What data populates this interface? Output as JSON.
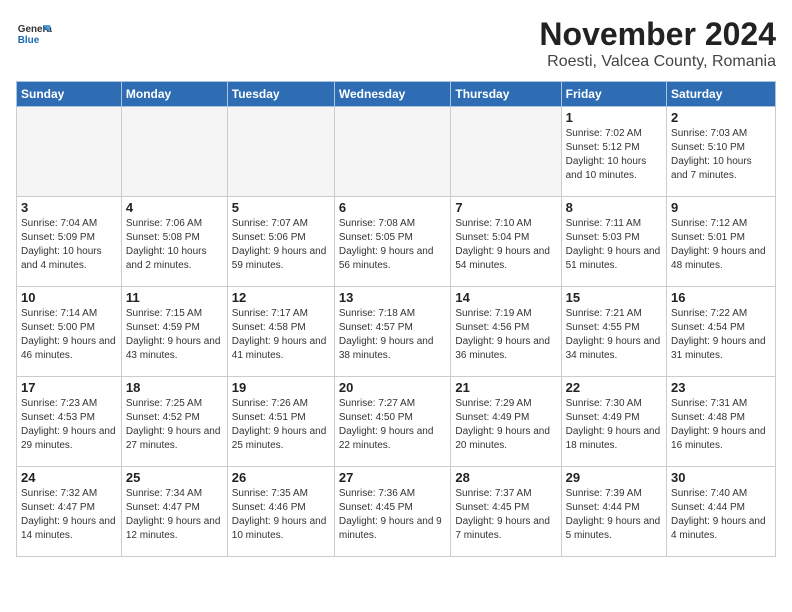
{
  "header": {
    "logo_general": "General",
    "logo_blue": "Blue",
    "month_title": "November 2024",
    "location": "Roesti, Valcea County, Romania"
  },
  "days_of_week": [
    "Sunday",
    "Monday",
    "Tuesday",
    "Wednesday",
    "Thursday",
    "Friday",
    "Saturday"
  ],
  "weeks": [
    [
      {
        "day": "",
        "empty": true
      },
      {
        "day": "",
        "empty": true
      },
      {
        "day": "",
        "empty": true
      },
      {
        "day": "",
        "empty": true
      },
      {
        "day": "",
        "empty": true
      },
      {
        "day": "1",
        "sunrise": "7:02 AM",
        "sunset": "5:12 PM",
        "daylight": "10 hours and 10 minutes."
      },
      {
        "day": "2",
        "sunrise": "7:03 AM",
        "sunset": "5:10 PM",
        "daylight": "10 hours and 7 minutes."
      }
    ],
    [
      {
        "day": "3",
        "sunrise": "7:04 AM",
        "sunset": "5:09 PM",
        "daylight": "10 hours and 4 minutes."
      },
      {
        "day": "4",
        "sunrise": "7:06 AM",
        "sunset": "5:08 PM",
        "daylight": "10 hours and 2 minutes."
      },
      {
        "day": "5",
        "sunrise": "7:07 AM",
        "sunset": "5:06 PM",
        "daylight": "9 hours and 59 minutes."
      },
      {
        "day": "6",
        "sunrise": "7:08 AM",
        "sunset": "5:05 PM",
        "daylight": "9 hours and 56 minutes."
      },
      {
        "day": "7",
        "sunrise": "7:10 AM",
        "sunset": "5:04 PM",
        "daylight": "9 hours and 54 minutes."
      },
      {
        "day": "8",
        "sunrise": "7:11 AM",
        "sunset": "5:03 PM",
        "daylight": "9 hours and 51 minutes."
      },
      {
        "day": "9",
        "sunrise": "7:12 AM",
        "sunset": "5:01 PM",
        "daylight": "9 hours and 48 minutes."
      }
    ],
    [
      {
        "day": "10",
        "sunrise": "7:14 AM",
        "sunset": "5:00 PM",
        "daylight": "9 hours and 46 minutes."
      },
      {
        "day": "11",
        "sunrise": "7:15 AM",
        "sunset": "4:59 PM",
        "daylight": "9 hours and 43 minutes."
      },
      {
        "day": "12",
        "sunrise": "7:17 AM",
        "sunset": "4:58 PM",
        "daylight": "9 hours and 41 minutes."
      },
      {
        "day": "13",
        "sunrise": "7:18 AM",
        "sunset": "4:57 PM",
        "daylight": "9 hours and 38 minutes."
      },
      {
        "day": "14",
        "sunrise": "7:19 AM",
        "sunset": "4:56 PM",
        "daylight": "9 hours and 36 minutes."
      },
      {
        "day": "15",
        "sunrise": "7:21 AM",
        "sunset": "4:55 PM",
        "daylight": "9 hours and 34 minutes."
      },
      {
        "day": "16",
        "sunrise": "7:22 AM",
        "sunset": "4:54 PM",
        "daylight": "9 hours and 31 minutes."
      }
    ],
    [
      {
        "day": "17",
        "sunrise": "7:23 AM",
        "sunset": "4:53 PM",
        "daylight": "9 hours and 29 minutes."
      },
      {
        "day": "18",
        "sunrise": "7:25 AM",
        "sunset": "4:52 PM",
        "daylight": "9 hours and 27 minutes."
      },
      {
        "day": "19",
        "sunrise": "7:26 AM",
        "sunset": "4:51 PM",
        "daylight": "9 hours and 25 minutes."
      },
      {
        "day": "20",
        "sunrise": "7:27 AM",
        "sunset": "4:50 PM",
        "daylight": "9 hours and 22 minutes."
      },
      {
        "day": "21",
        "sunrise": "7:29 AM",
        "sunset": "4:49 PM",
        "daylight": "9 hours and 20 minutes."
      },
      {
        "day": "22",
        "sunrise": "7:30 AM",
        "sunset": "4:49 PM",
        "daylight": "9 hours and 18 minutes."
      },
      {
        "day": "23",
        "sunrise": "7:31 AM",
        "sunset": "4:48 PM",
        "daylight": "9 hours and 16 minutes."
      }
    ],
    [
      {
        "day": "24",
        "sunrise": "7:32 AM",
        "sunset": "4:47 PM",
        "daylight": "9 hours and 14 minutes."
      },
      {
        "day": "25",
        "sunrise": "7:34 AM",
        "sunset": "4:47 PM",
        "daylight": "9 hours and 12 minutes."
      },
      {
        "day": "26",
        "sunrise": "7:35 AM",
        "sunset": "4:46 PM",
        "daylight": "9 hours and 10 minutes."
      },
      {
        "day": "27",
        "sunrise": "7:36 AM",
        "sunset": "4:45 PM",
        "daylight": "9 hours and 9 minutes."
      },
      {
        "day": "28",
        "sunrise": "7:37 AM",
        "sunset": "4:45 PM",
        "daylight": "9 hours and 7 minutes."
      },
      {
        "day": "29",
        "sunrise": "7:39 AM",
        "sunset": "4:44 PM",
        "daylight": "9 hours and 5 minutes."
      },
      {
        "day": "30",
        "sunrise": "7:40 AM",
        "sunset": "4:44 PM",
        "daylight": "9 hours and 4 minutes."
      }
    ]
  ]
}
